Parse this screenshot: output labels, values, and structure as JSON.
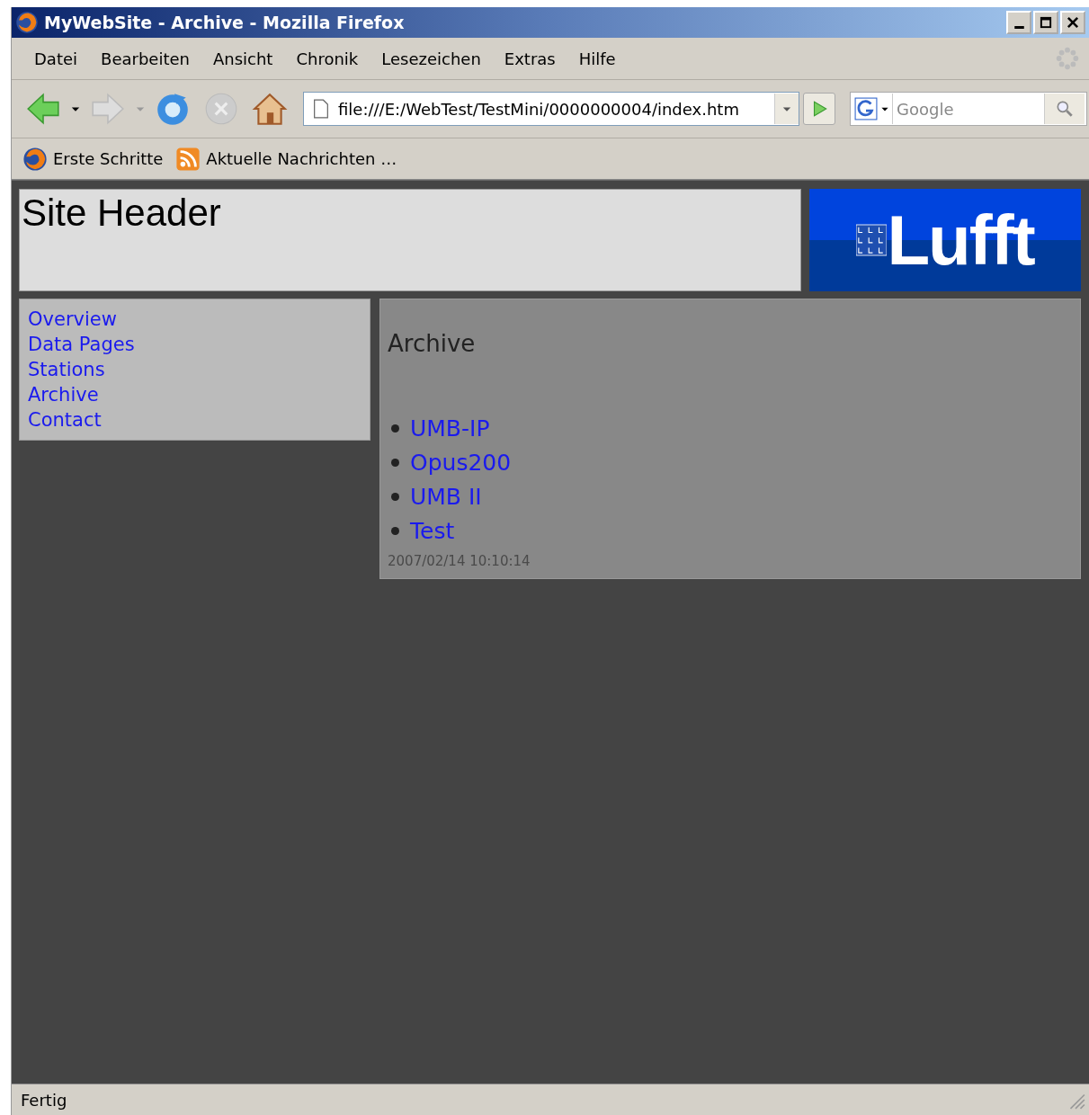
{
  "window": {
    "title": "MyWebSite - Archive - Mozilla Firefox"
  },
  "menu": [
    "Datei",
    "Bearbeiten",
    "Ansicht",
    "Chronik",
    "Lesezeichen",
    "Extras",
    "Hilfe"
  ],
  "toolbar": {
    "address": "file:///E:/WebTest/TestMini/0000000004/index.htm",
    "search_placeholder": "Google"
  },
  "bookmarks": [
    {
      "label": "Erste Schritte",
      "kind": "firefox"
    },
    {
      "label": "Aktuelle Nachrichten …",
      "kind": "feed"
    }
  ],
  "page": {
    "header": "Site Header",
    "logo": "Lufft",
    "nav": [
      "Overview",
      "Data Pages",
      "Stations",
      "Archive",
      "Contact"
    ],
    "heading": "Archive",
    "links": [
      "UMB-IP",
      "Opus200",
      "UMB II",
      "Test"
    ],
    "timestamp": "2007/02/14 10:10:14"
  },
  "status_bar": "Fertig"
}
